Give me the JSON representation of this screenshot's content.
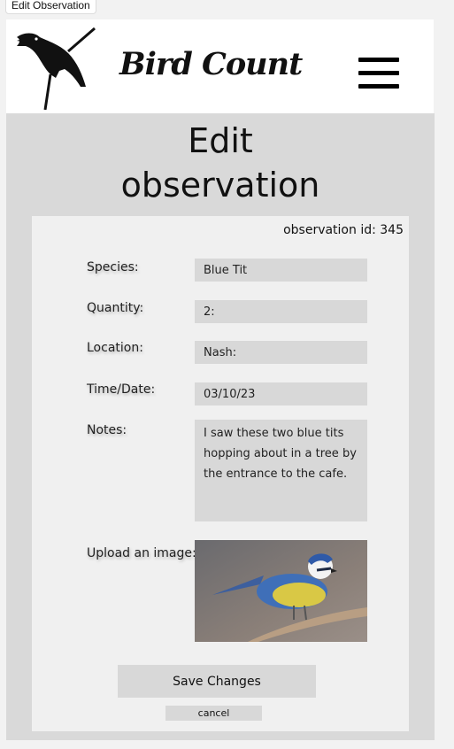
{
  "window": {
    "tab_title": "Edit Observation"
  },
  "header": {
    "brand": "Bird Count",
    "logo_icon": "bird-silhouette-icon",
    "menu_icon": "hamburger-menu-icon"
  },
  "page": {
    "title_line1": "Edit",
    "title_line2": "observation"
  },
  "form": {
    "observation_id": "observation id: 345",
    "fields": {
      "species": {
        "label": "Species:",
        "value": "Blue Tit"
      },
      "quantity": {
        "label": "Quantity:",
        "value": "2:"
      },
      "location": {
        "label": "Location:",
        "value": "Nash:"
      },
      "datetime": {
        "label": "Time/Date:",
        "value": "03/10/23"
      },
      "notes": {
        "label": "Notes:",
        "value": "I saw these two blue tits hopping about in a tree by the entrance to the cafe."
      }
    },
    "upload": {
      "label": "Upload an image:"
    },
    "save_label": "Save Changes",
    "cancel_label": "cancel"
  },
  "colors": {
    "page_bg": "#f2f2f2",
    "panel_bg": "#d9d9d9",
    "card_bg": "#f0f0f0",
    "field_bg": "#d8d8d8"
  }
}
